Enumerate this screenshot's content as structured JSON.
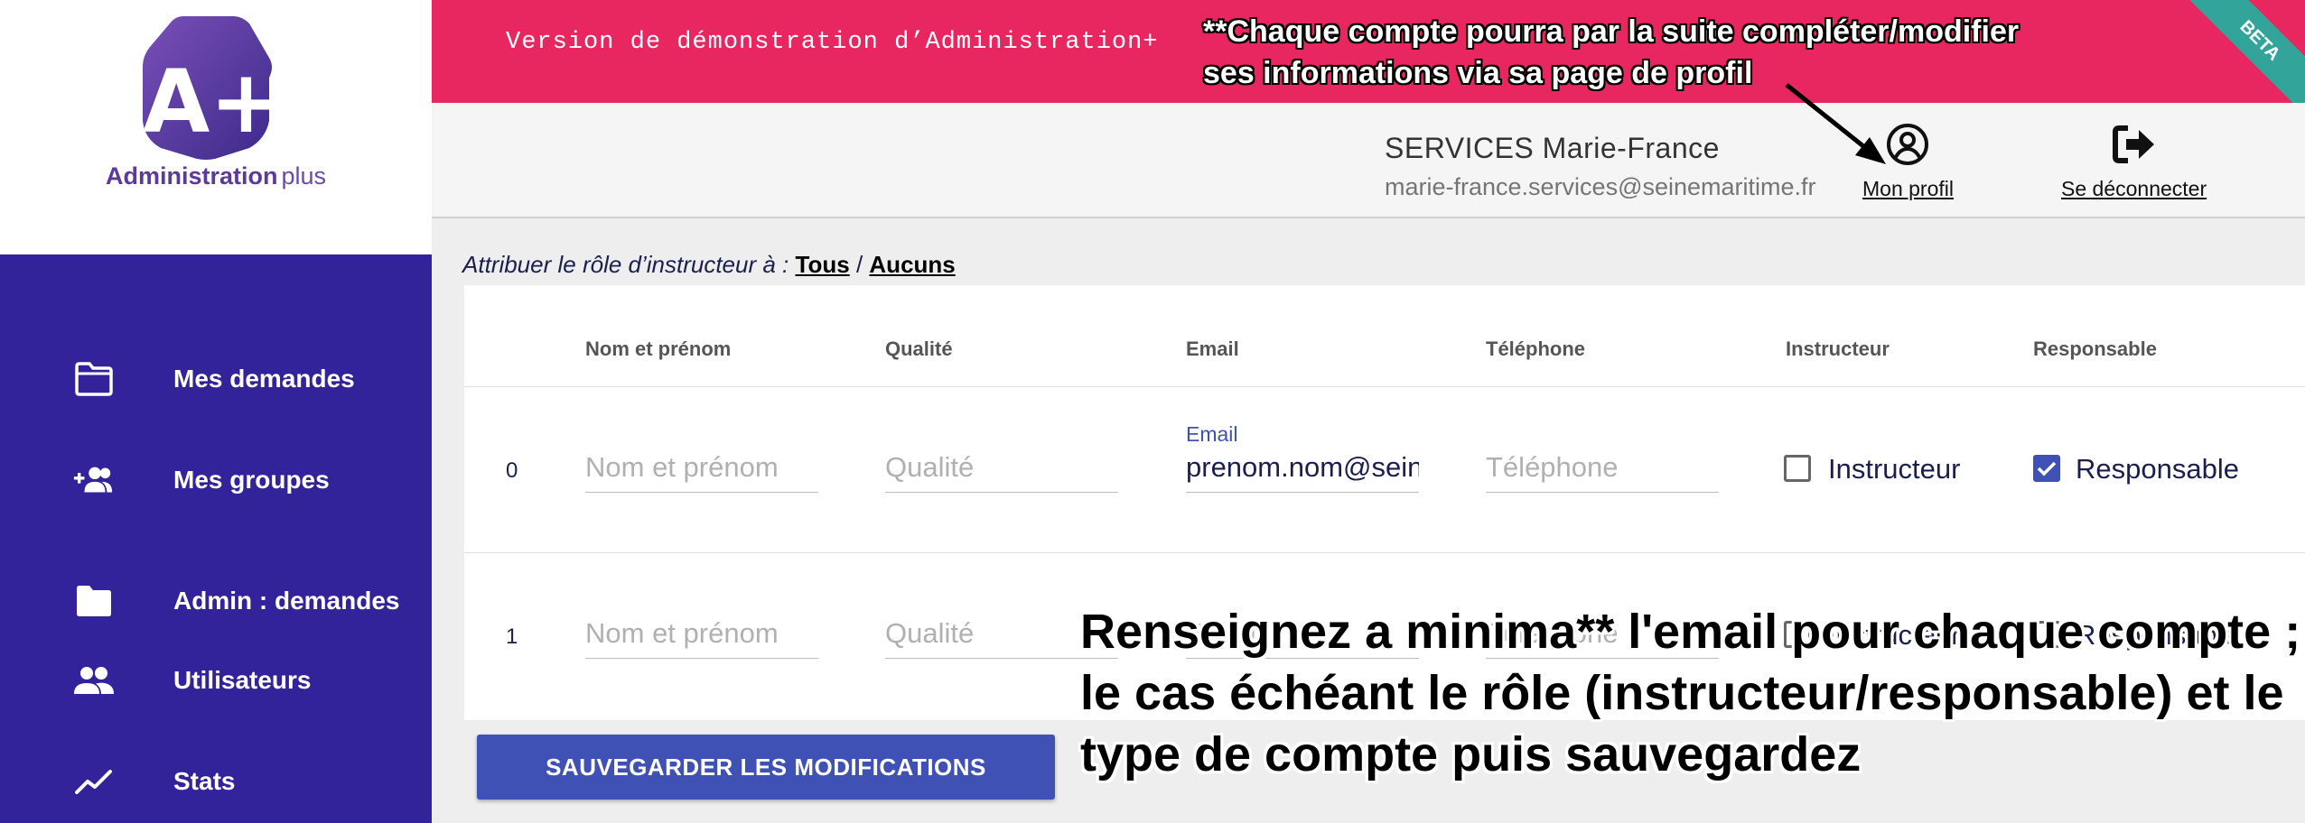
{
  "brand": {
    "logo_letters": "A+",
    "name": "Administration",
    "name_suffix": "plus",
    "color": "#5b3a9a"
  },
  "banner": {
    "text": "Version de démonstration d’Administration+",
    "ribbon": "BETA",
    "color": "#e8265f"
  },
  "sidebar": {
    "color": "#32239a",
    "items": [
      {
        "label": "Mes demandes",
        "icon": "folder-outline-icon"
      },
      {
        "label": "Mes groupes",
        "icon": "group-add-icon"
      },
      {
        "label": "Admin : demandes",
        "icon": "folder-filled-icon"
      },
      {
        "label": "Utilisateurs",
        "icon": "people-icon"
      },
      {
        "label": "Stats",
        "icon": "trending-up-icon"
      }
    ]
  },
  "user": {
    "name": "SERVICES Marie-France",
    "email": "marie-france.services@seinemaritime.fr",
    "profile_label": "Mon profil",
    "logout_label": "Se déconnecter"
  },
  "assign": {
    "prefix": "Attribuer le rôle d’instructeur à :",
    "all": "Tous",
    "separator": "/",
    "none": "Aucuns"
  },
  "table": {
    "headers": [
      "Nom et prénom",
      "Qualité",
      "Email",
      "Téléphone",
      "Instructeur",
      "Responsable"
    ],
    "rows": [
      {
        "index": "0",
        "name_placeholder": "Nom et prénom",
        "quality_placeholder": "Qualité",
        "email_label": "Email",
        "email_value": "prenom.nom@seinemaritime.fr",
        "phone_placeholder": "Téléphone",
        "instructeur_label": "Instructeur",
        "instructeur_checked": false,
        "responsable_label": "Responsable",
        "responsable_checked": true
      },
      {
        "index": "1",
        "name_placeholder": "Nom et prénom",
        "quality_placeholder": "Qualité",
        "email_placeholder": "Email",
        "phone_placeholder": "Téléphone",
        "instructeur_label": "Instructeur",
        "instructeur_checked": false,
        "responsable_label": "Responsable",
        "responsable_checked": false
      }
    ]
  },
  "save_button": "SAUVEGARDER LES MODIFICATIONS",
  "annotations": {
    "top_line1": "**Chaque compte pourra par la suite compléter/modifier",
    "top_line2": "ses informations via sa page de profil",
    "bottom_line1": "Renseignez a minima** l'email pour chaque compte ;",
    "bottom_line2": "le cas échéant le rôle (instructeur/responsable) et le",
    "bottom_line3": "type de compte puis sauvegardez"
  },
  "accent_color": "#3f51b5"
}
